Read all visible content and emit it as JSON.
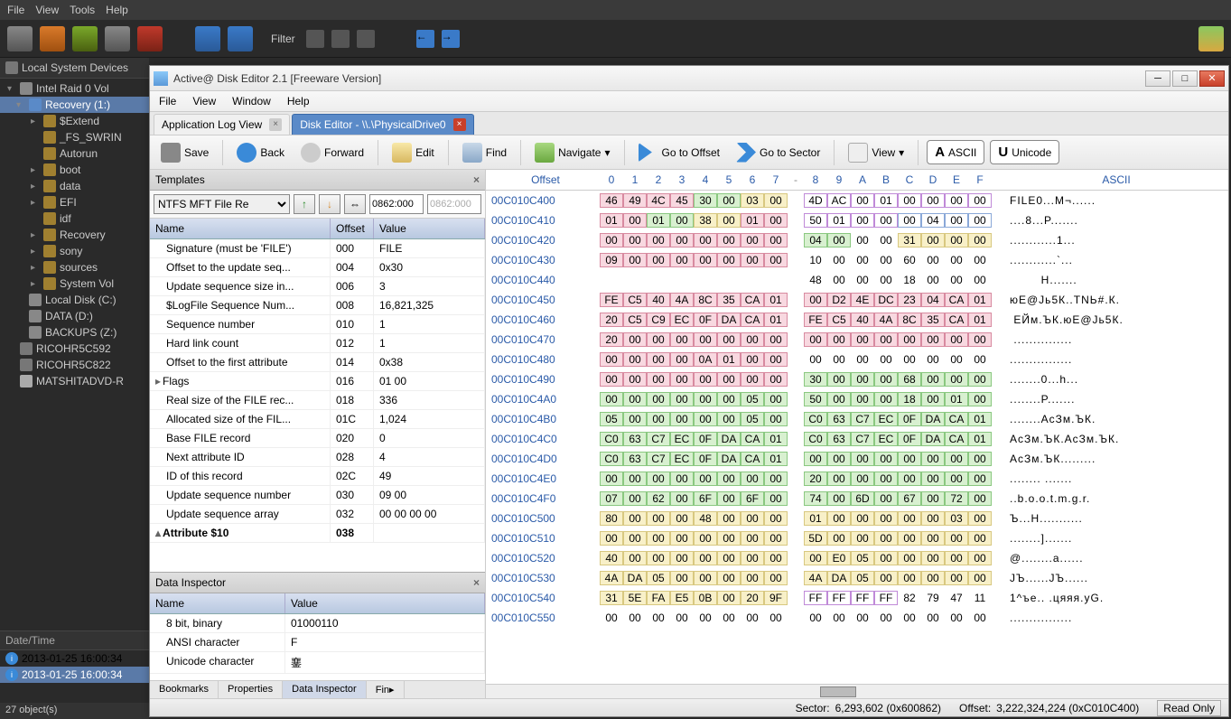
{
  "outer_menu": [
    "File",
    "View",
    "Tools",
    "Help"
  ],
  "filter_label": "Filter",
  "left_header": "Local System Devices",
  "tree": [
    {
      "level": 0,
      "icon": "drive",
      "label": "Intel   Raid 0 Vol",
      "exp": "▾"
    },
    {
      "level": 1,
      "icon": "partition",
      "label": "Recovery (1:)",
      "exp": "▾",
      "selected": true
    },
    {
      "level": 2,
      "icon": "folder",
      "label": "$Extend",
      "exp": "▸"
    },
    {
      "level": 2,
      "icon": "folder",
      "label": "_FS_SWRIN",
      "exp": ""
    },
    {
      "level": 2,
      "icon": "folder",
      "label": "Autorun",
      "exp": ""
    },
    {
      "level": 2,
      "icon": "folder",
      "label": "boot",
      "exp": "▸"
    },
    {
      "level": 2,
      "icon": "folder",
      "label": "data",
      "exp": "▸"
    },
    {
      "level": 2,
      "icon": "folder",
      "label": "EFI",
      "exp": "▸"
    },
    {
      "level": 2,
      "icon": "folder",
      "label": "idf",
      "exp": ""
    },
    {
      "level": 2,
      "icon": "folder",
      "label": "Recovery",
      "exp": "▸"
    },
    {
      "level": 2,
      "icon": "folder",
      "label": "sony",
      "exp": "▸"
    },
    {
      "level": 2,
      "icon": "folder",
      "label": "sources",
      "exp": "▸"
    },
    {
      "level": 2,
      "icon": "folder",
      "label": "System Vol",
      "exp": "▸"
    },
    {
      "level": 1,
      "icon": "drive",
      "label": "Local Disk (C:)",
      "exp": ""
    },
    {
      "level": 1,
      "icon": "drive",
      "label": "DATA (D:)",
      "exp": ""
    },
    {
      "level": 1,
      "icon": "drive",
      "label": "BACKUPS (Z:)",
      "exp": ""
    },
    {
      "level": 0,
      "icon": "device",
      "label": "RICOHR5C592",
      "exp": ""
    },
    {
      "level": 0,
      "icon": "device",
      "label": "RICOHR5C822",
      "exp": ""
    },
    {
      "level": 0,
      "icon": "cd",
      "label": "MATSHITADVD-R",
      "exp": ""
    }
  ],
  "datetime_header": "Date/Time",
  "datetime_rows": [
    "2013-01-25 16:00:34",
    "2013-01-25 16:00:34"
  ],
  "outer_status": "27 object(s)",
  "inner_title": "Active@ Disk Editor 2.1 [Freeware Version]",
  "inner_menu": [
    "File",
    "View",
    "Window",
    "Help"
  ],
  "inner_tabs": [
    {
      "label": "Application Log View",
      "active": false,
      "closable": true
    },
    {
      "label": "Disk Editor - \\\\.\\PhysicalDrive0",
      "active": true,
      "closable": true
    }
  ],
  "toolbar": {
    "save": "Save",
    "back": "Back",
    "forward": "Forward",
    "edit": "Edit",
    "find": "Find",
    "navigate": "Navigate",
    "goto_offset": "Go to Offset",
    "goto_sector": "Go to Sector",
    "view": "View",
    "ascii": "ASCII",
    "unicode": "Unicode"
  },
  "templates_title": "Templates",
  "template_select": "NTFS MFT File Re",
  "offset1": "0862:000",
  "offset2": "0862:000",
  "templates_cols": {
    "name": "Name",
    "offset": "Offset",
    "value": "Value"
  },
  "template_rows": [
    {
      "name": "Signature (must be 'FILE')",
      "offset": "000",
      "value": "FILE",
      "indent": true
    },
    {
      "name": "Offset to the update seq...",
      "offset": "004",
      "value": "0x30",
      "indent": true
    },
    {
      "name": "Update sequence size in...",
      "offset": "006",
      "value": "3",
      "indent": true
    },
    {
      "name": "$LogFile Sequence Num...",
      "offset": "008",
      "value": "16,821,325",
      "indent": true
    },
    {
      "name": "Sequence number",
      "offset": "010",
      "value": "1",
      "indent": true
    },
    {
      "name": "Hard link count",
      "offset": "012",
      "value": "1",
      "indent": true
    },
    {
      "name": "Offset to the first attribute",
      "offset": "014",
      "value": "0x38",
      "indent": true
    },
    {
      "name": "Flags",
      "offset": "016",
      "value": "01 00",
      "indent": false,
      "exp": "▸"
    },
    {
      "name": "Real size of the FILE rec...",
      "offset": "018",
      "value": "336",
      "indent": true
    },
    {
      "name": "Allocated size of the FIL...",
      "offset": "01C",
      "value": "1,024",
      "indent": true
    },
    {
      "name": "Base FILE record",
      "offset": "020",
      "value": "0",
      "indent": true
    },
    {
      "name": "Next attribute ID",
      "offset": "028",
      "value": "4",
      "indent": true
    },
    {
      "name": "ID of this record",
      "offset": "02C",
      "value": "49",
      "indent": true
    },
    {
      "name": "Update sequence number",
      "offset": "030",
      "value": "09 00",
      "indent": true
    },
    {
      "name": "Update sequence array",
      "offset": "032",
      "value": "00 00 00 00",
      "indent": true
    },
    {
      "name": "Attribute $10",
      "offset": "038",
      "value": "",
      "bold": true,
      "exp": "▴"
    }
  ],
  "inspector_title": "Data Inspector",
  "inspector_cols": {
    "name": "Name",
    "value": "Value"
  },
  "inspector_rows": [
    {
      "name": "8 bit, binary",
      "value": "01000110"
    },
    {
      "name": "ANSI character",
      "value": "F"
    },
    {
      "name": "Unicode character",
      "value": "䥆"
    }
  ],
  "inspector_tabs": [
    "Bookmarks",
    "Properties",
    "Data Inspector",
    "Fin▸"
  ],
  "inspector_active_tab": 2,
  "hex_header": {
    "offset": "Offset",
    "cols": [
      "0",
      "1",
      "2",
      "3",
      "4",
      "5",
      "6",
      "7",
      "-",
      "8",
      "9",
      "A",
      "B",
      "C",
      "D",
      "E",
      "F"
    ],
    "ascii": "ASCII"
  },
  "hex_rows": [
    {
      "addr": "00C010C400",
      "b": [
        "46",
        "49",
        "4C",
        "45",
        "30",
        "00",
        "03",
        "00",
        "4D",
        "AC",
        "00",
        "01",
        "00",
        "00",
        "00",
        "00"
      ],
      "asc": "FILE0...M¬......",
      "hl": [
        [
          0,
          3,
          "pink"
        ],
        [
          4,
          5,
          "green"
        ],
        [
          6,
          7,
          "yellow"
        ],
        [
          8,
          15,
          "purple"
        ]
      ]
    },
    {
      "addr": "00C010C410",
      "b": [
        "01",
        "00",
        "01",
        "00",
        "38",
        "00",
        "01",
        "00",
        "50",
        "01",
        "00",
        "00",
        "00",
        "04",
        "00",
        "00"
      ],
      "asc": "....8...P.......",
      "hl": [
        [
          0,
          1,
          "pink"
        ],
        [
          2,
          3,
          "green"
        ],
        [
          4,
          5,
          "yellow"
        ],
        [
          6,
          7,
          "pink"
        ],
        [
          8,
          11,
          "purple"
        ],
        [
          12,
          15,
          "blue"
        ]
      ]
    },
    {
      "addr": "00C010C420",
      "b": [
        "00",
        "00",
        "00",
        "00",
        "00",
        "00",
        "00",
        "00",
        "04",
        "00",
        "00",
        "00",
        "31",
        "00",
        "00",
        "00"
      ],
      "asc": "............1...",
      "hl": [
        [
          0,
          7,
          "pink"
        ],
        [
          8,
          9,
          "green"
        ],
        [
          12,
          15,
          "yellow"
        ]
      ]
    },
    {
      "addr": "00C010C430",
      "b": [
        "09",
        "00",
        "00",
        "00",
        "00",
        "00",
        "00",
        "00",
        "10",
        "00",
        "00",
        "00",
        "60",
        "00",
        "00",
        "00"
      ],
      "asc": "............`...",
      "hl": [
        [
          0,
          1,
          "pink"
        ],
        [
          2,
          7,
          "pink"
        ]
      ]
    },
    {
      "addr": "00C010C440",
      "b": [
        "",
        "",
        "",
        "",
        "",
        "",
        "",
        "",
        "48",
        "00",
        "00",
        "00",
        "18",
        "00",
        "00",
        "00"
      ],
      "asc": "        H......."
    },
    {
      "addr": "00C010C450",
      "b": [
        "FE",
        "C5",
        "40",
        "4A",
        "8C",
        "35",
        "CA",
        "01",
        "00",
        "D2",
        "4E",
        "DC",
        "23",
        "04",
        "CA",
        "01"
      ],
      "asc": "юЕ@Jь5К..ТNЬ#.К.",
      "hl": [
        [
          0,
          15,
          "pink"
        ]
      ]
    },
    {
      "addr": "00C010C460",
      "b": [
        "20",
        "C5",
        "C9",
        "EC",
        "0F",
        "DA",
        "CA",
        "01",
        "FE",
        "C5",
        "40",
        "4A",
        "8C",
        "35",
        "CA",
        "01"
      ],
      "asc": " ЕЙм.ЪК.юЕ@Jь5К.",
      "hl": [
        [
          0,
          15,
          "pink"
        ]
      ]
    },
    {
      "addr": "00C010C470",
      "b": [
        "20",
        "00",
        "00",
        "00",
        "00",
        "00",
        "00",
        "00",
        "00",
        "00",
        "00",
        "00",
        "00",
        "00",
        "00",
        "00"
      ],
      "asc": " ...............",
      "hl": [
        [
          0,
          15,
          "pink"
        ]
      ]
    },
    {
      "addr": "00C010C480",
      "b": [
        "00",
        "00",
        "00",
        "00",
        "0A",
        "01",
        "00",
        "00",
        "00",
        "00",
        "00",
        "00",
        "00",
        "00",
        "00",
        "00"
      ],
      "asc": "................",
      "hl": [
        [
          0,
          7,
          "pink"
        ]
      ]
    },
    {
      "addr": "00C010C490",
      "b": [
        "00",
        "00",
        "00",
        "00",
        "00",
        "00",
        "00",
        "00",
        "30",
        "00",
        "00",
        "00",
        "68",
        "00",
        "00",
        "00"
      ],
      "asc": "........0...h...",
      "hl": [
        [
          0,
          7,
          "pink"
        ],
        [
          8,
          15,
          "green"
        ]
      ]
    },
    {
      "addr": "00C010C4A0",
      "b": [
        "00",
        "00",
        "00",
        "00",
        "00",
        "00",
        "05",
        "00",
        "50",
        "00",
        "00",
        "00",
        "18",
        "00",
        "01",
        "00"
      ],
      "asc": "........P.......",
      "hl": [
        [
          0,
          15,
          "green"
        ]
      ]
    },
    {
      "addr": "00C010C4B0",
      "b": [
        "05",
        "00",
        "00",
        "00",
        "00",
        "00",
        "05",
        "00",
        "C0",
        "63",
        "C7",
        "EC",
        "0F",
        "DA",
        "CA",
        "01"
      ],
      "asc": "........АсЗм.ЪК.",
      "hl": [
        [
          0,
          15,
          "green"
        ]
      ]
    },
    {
      "addr": "00C010C4C0",
      "b": [
        "C0",
        "63",
        "C7",
        "EC",
        "0F",
        "DA",
        "CA",
        "01",
        "C0",
        "63",
        "C7",
        "EC",
        "0F",
        "DA",
        "CA",
        "01"
      ],
      "asc": "АсЗм.ЪК.АсЗм.ЪК.",
      "hl": [
        [
          0,
          15,
          "green"
        ]
      ]
    },
    {
      "addr": "00C010C4D0",
      "b": [
        "C0",
        "63",
        "C7",
        "EC",
        "0F",
        "DA",
        "CA",
        "01",
        "00",
        "00",
        "00",
        "00",
        "00",
        "00",
        "00",
        "00"
      ],
      "asc": "АсЗм.ЪК.........",
      "hl": [
        [
          0,
          15,
          "green"
        ]
      ]
    },
    {
      "addr": "00C010C4E0",
      "b": [
        "00",
        "00",
        "00",
        "00",
        "00",
        "00",
        "00",
        "00",
        "20",
        "00",
        "00",
        "00",
        "00",
        "00",
        "00",
        "00"
      ],
      "asc": "........ .......",
      "hl": [
        [
          0,
          15,
          "green"
        ]
      ]
    },
    {
      "addr": "00C010C4F0",
      "b": [
        "07",
        "00",
        "62",
        "00",
        "6F",
        "00",
        "6F",
        "00",
        "74",
        "00",
        "6D",
        "00",
        "67",
        "00",
        "72",
        "00"
      ],
      "asc": "..b.o.o.t.m.g.r.",
      "hl": [
        [
          0,
          15,
          "green"
        ]
      ]
    },
    {
      "addr": "00C010C500",
      "b": [
        "80",
        "00",
        "00",
        "00",
        "48",
        "00",
        "00",
        "00",
        "01",
        "00",
        "00",
        "00",
        "00",
        "00",
        "03",
        "00"
      ],
      "asc": "Ъ...H...........",
      "hl": [
        [
          0,
          15,
          "yellow"
        ]
      ]
    },
    {
      "addr": "00C010C510",
      "b": [
        "00",
        "00",
        "00",
        "00",
        "00",
        "00",
        "00",
        "00",
        "5D",
        "00",
        "00",
        "00",
        "00",
        "00",
        "00",
        "00"
      ],
      "asc": "........].......",
      "hl": [
        [
          0,
          15,
          "yellow"
        ]
      ]
    },
    {
      "addr": "00C010C520",
      "b": [
        "40",
        "00",
        "00",
        "00",
        "00",
        "00",
        "00",
        "00",
        "00",
        "E0",
        "05",
        "00",
        "00",
        "00",
        "00",
        "00"
      ],
      "asc": "@........а......",
      "hl": [
        [
          0,
          15,
          "yellow"
        ]
      ]
    },
    {
      "addr": "00C010C530",
      "b": [
        "4A",
        "DA",
        "05",
        "00",
        "00",
        "00",
        "00",
        "00",
        "4A",
        "DA",
        "05",
        "00",
        "00",
        "00",
        "00",
        "00"
      ],
      "asc": "JЪ......JЪ......",
      "hl": [
        [
          0,
          15,
          "yellow"
        ]
      ]
    },
    {
      "addr": "00C010C540",
      "b": [
        "31",
        "5E",
        "FA",
        "E5",
        "0B",
        "00",
        "20",
        "9F",
        "FF",
        "FF",
        "FF",
        "FF",
        "82",
        "79",
        "47",
        "11"
      ],
      "asc": "1^ъе.. .цяяя.yG.",
      "hl": [
        [
          0,
          7,
          "yellow"
        ],
        [
          8,
          11,
          "purple"
        ]
      ]
    },
    {
      "addr": "00C010C550",
      "b": [
        "00",
        "00",
        "00",
        "00",
        "00",
        "00",
        "00",
        "00",
        "00",
        "00",
        "00",
        "00",
        "00",
        "00",
        "00",
        "00"
      ],
      "asc": "................"
    }
  ],
  "status": {
    "sector_label": "Sector:",
    "sector_val": "6,293,602 (0x600862)",
    "offset_label": "Offset:",
    "offset_val": "3,222,324,224 (0xC010C400)",
    "readonly": "Read Only"
  }
}
